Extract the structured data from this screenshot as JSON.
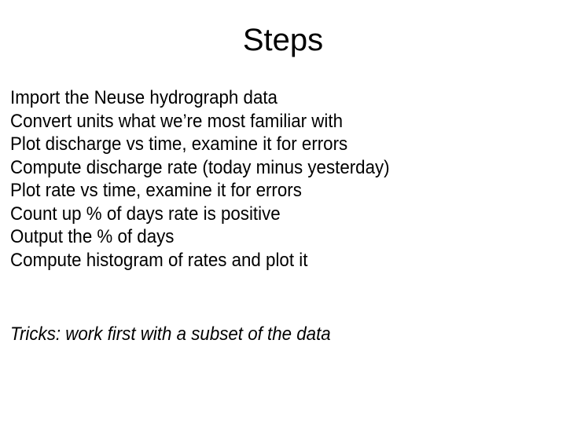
{
  "slide": {
    "title": "Steps",
    "steps": [
      "Import the Neuse hydrograph data",
      "Convert units what we’re most familiar with",
      "Plot discharge vs time, examine it for errors",
      "Compute discharge rate (today minus yesterday)",
      "Plot rate vs time, examine it for errors",
      "Count up % of days rate is positive",
      "Output the % of days",
      "Compute histogram of rates and plot it"
    ],
    "tricks": "Tricks: work first with a subset of the data"
  }
}
